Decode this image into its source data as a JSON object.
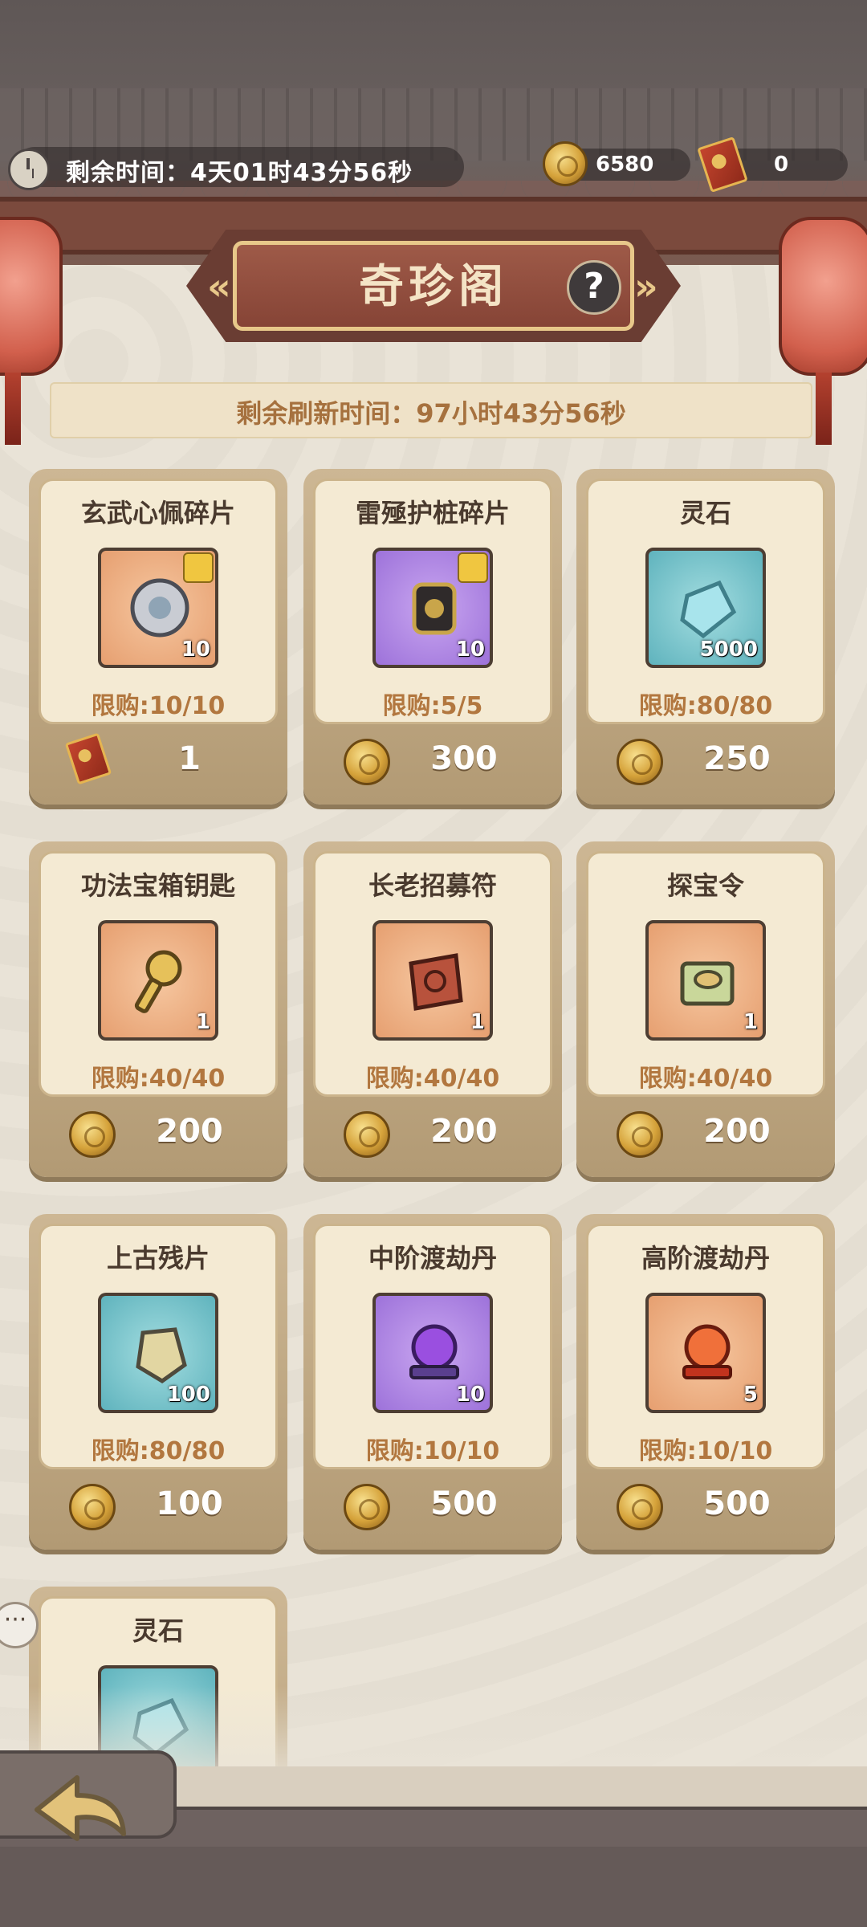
{
  "header": {
    "remaining_time": "剩余时间：4天01时43分56秒",
    "currencies": [
      {
        "icon": "gold-coin-icon",
        "value": "6580"
      },
      {
        "icon": "ticket-icon",
        "value": "0"
      }
    ]
  },
  "shop": {
    "title": "奇珍阁",
    "help_label": "?",
    "refresh_time": "剩余刷新时间：97小时43分56秒"
  },
  "items": [
    {
      "name": "玄武心佩碎片",
      "count": "10",
      "limit": "限购:10/10",
      "price": "1",
      "currency": "ticket",
      "frame": "orange",
      "puzzle": true
    },
    {
      "name": "雷殛护桩碎片",
      "count": "10",
      "limit": "限购:5/5",
      "price": "300",
      "currency": "coin",
      "frame": "purple",
      "puzzle": true
    },
    {
      "name": "灵石",
      "count": "5000",
      "limit": "限购:80/80",
      "price": "250",
      "currency": "coin",
      "frame": "teal",
      "puzzle": false
    },
    {
      "name": "功法宝箱钥匙",
      "count": "1",
      "limit": "限购:40/40",
      "price": "200",
      "currency": "coin",
      "frame": "orange",
      "puzzle": false
    },
    {
      "name": "长老招募符",
      "count": "1",
      "limit": "限购:40/40",
      "price": "200",
      "currency": "coin",
      "frame": "orange",
      "puzzle": false
    },
    {
      "name": "探宝令",
      "count": "1",
      "limit": "限购:40/40",
      "price": "200",
      "currency": "coin",
      "frame": "orange",
      "puzzle": false
    },
    {
      "name": "上古残片",
      "count": "100",
      "limit": "限购:80/80",
      "price": "100",
      "currency": "coin",
      "frame": "teal",
      "puzzle": false
    },
    {
      "name": "中阶渡劫丹",
      "count": "10",
      "limit": "限购:10/10",
      "price": "500",
      "currency": "coin",
      "frame": "purple",
      "puzzle": false
    },
    {
      "name": "高阶渡劫丹",
      "count": "5",
      "limit": "限购:10/10",
      "price": "500",
      "currency": "coin",
      "frame": "orange",
      "puzzle": false
    },
    {
      "name": "灵石",
      "count": "",
      "limit": "",
      "price": "",
      "currency": "coin",
      "frame": "teal",
      "puzzle": false
    }
  ],
  "colors": {
    "accent_gold": "#d5a23a",
    "limit_text": "#b2773f",
    "plaque": "#864436"
  }
}
